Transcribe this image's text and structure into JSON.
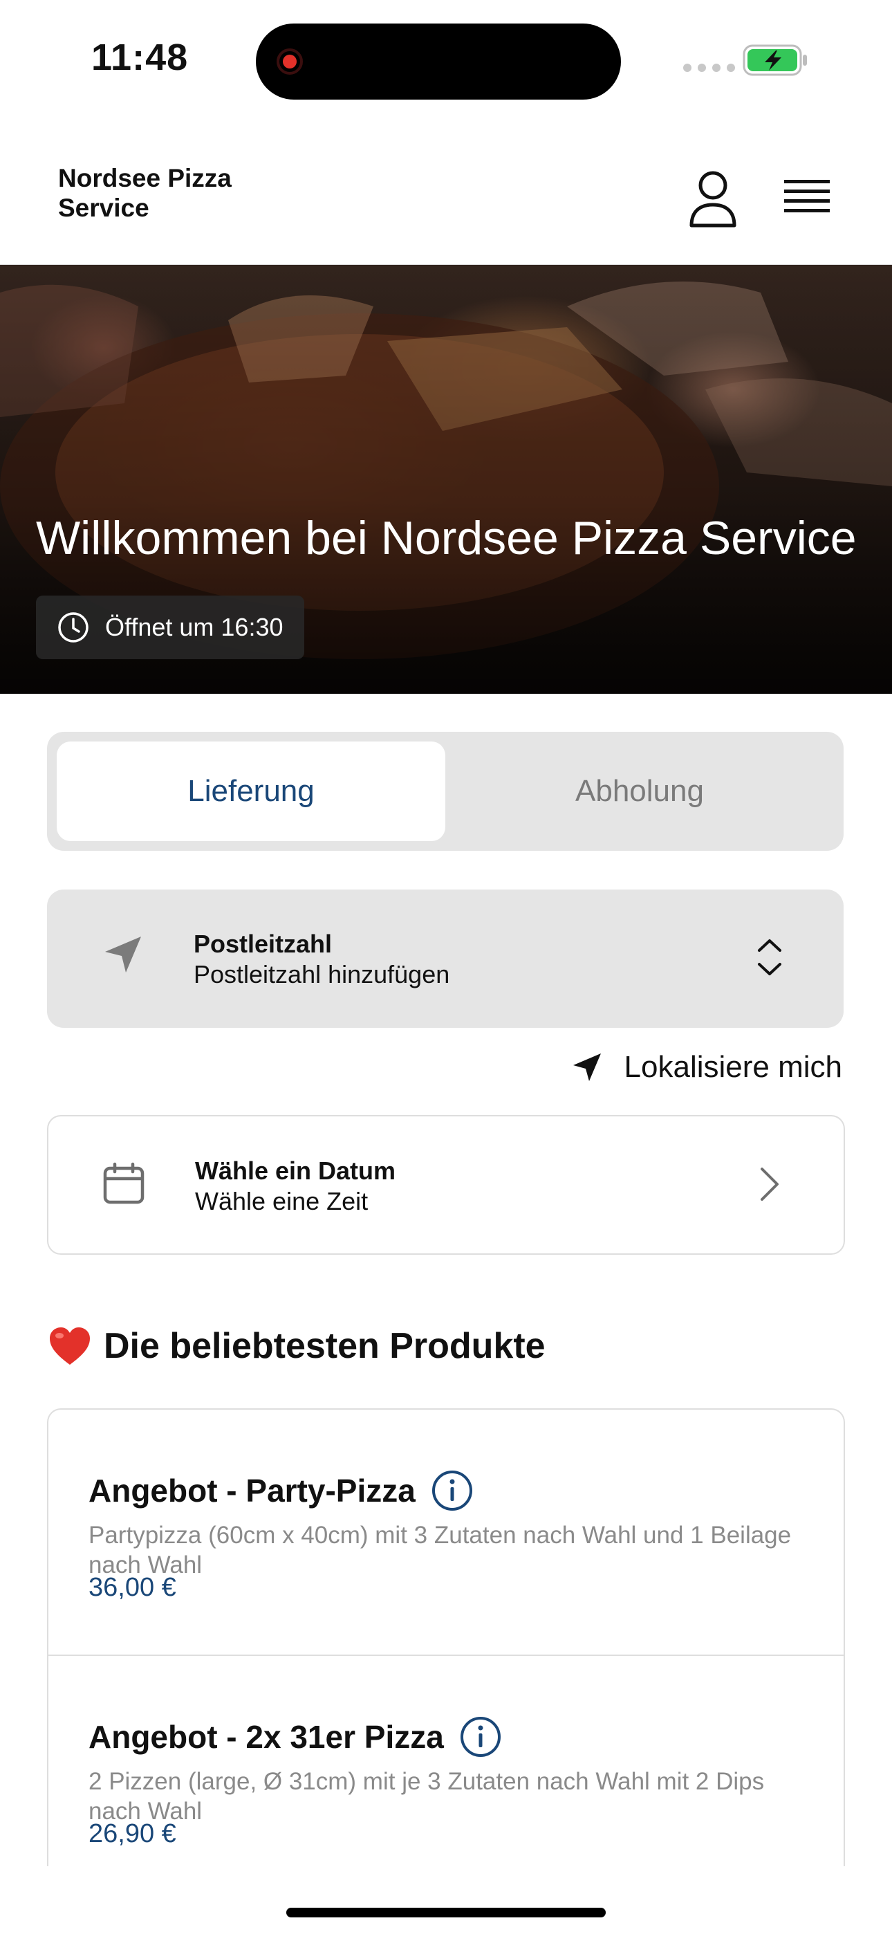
{
  "status_bar": {
    "time": "11:48"
  },
  "header": {
    "brand": "Nordsee Pizza Service"
  },
  "hero": {
    "title": "Willkommen bei Nordsee Pizza Service",
    "opening_text": "Öffnet um 16:30"
  },
  "order_mode": {
    "tabs": [
      "Lieferung",
      "Abholung"
    ],
    "selected": "Lieferung"
  },
  "postal": {
    "label": "Postleitzahl",
    "placeholder": "Postleitzahl hinzufügen"
  },
  "locate": {
    "label": "Lokalisiere mich"
  },
  "date": {
    "label": "Wähle ein Datum",
    "sub": "Wähle eine Zeit"
  },
  "popular": {
    "heading": "Die beliebtesten Produkte",
    "products": [
      {
        "name": "Angebot - Party-Pizza",
        "description": "Partypizza (60cm x 40cm) mit 3 Zutaten nach Wahl und 1 Beilage nach Wahl",
        "price": "36,00 €"
      },
      {
        "name": "Angebot - 2x 31er Pizza",
        "description": "2 Pizzen (large, Ø 31cm) mit je 3 Zutaten nach Wahl mit 2 Dips nach Wahl",
        "price": "26,90 €"
      }
    ]
  },
  "colors": {
    "accent": "#1a4778",
    "panel": "#e5e5e5",
    "muted_text": "#8a8a8a",
    "battery_green": "#34c759",
    "record_red": "#e3312a"
  }
}
